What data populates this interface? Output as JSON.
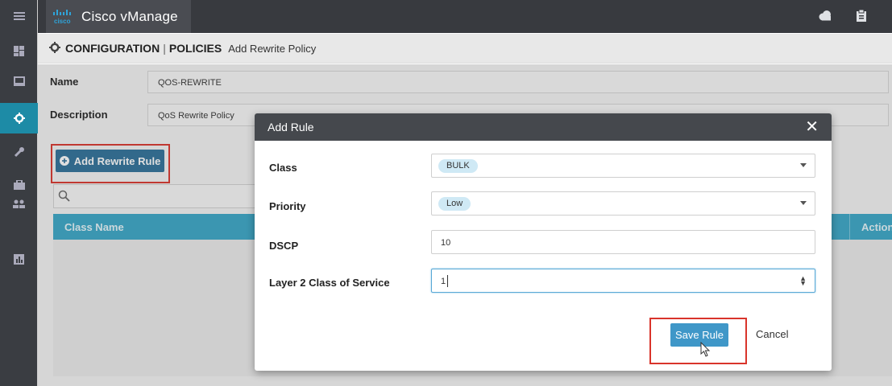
{
  "app": {
    "title": "Cisco vManage",
    "logo_text": "cisco"
  },
  "sidebar": {
    "items": [
      {
        "icon": "hamburger-menu-icon",
        "active": false
      },
      {
        "icon": "dashboard-icon",
        "active": false
      },
      {
        "icon": "monitor-icon",
        "active": false
      },
      {
        "icon": "gear-icon",
        "active": true
      },
      {
        "icon": "wrench-icon",
        "active": false
      },
      {
        "icon": "briefcase-icon",
        "active": false
      },
      {
        "icon": "users-icon",
        "active": false
      },
      {
        "icon": "analytics-icon",
        "active": false
      }
    ]
  },
  "topbar": {
    "icons": [
      "cloud-icon",
      "clipboard-icon"
    ]
  },
  "breadcrumb": {
    "section": "CONFIGURATION",
    "separator": "|",
    "area": "POLICIES",
    "page": "Add Rewrite Policy"
  },
  "form": {
    "name_label": "Name",
    "name_value": "QOS-REWRITE",
    "description_label": "Description",
    "description_value": "QoS Rewrite Policy"
  },
  "toolbar": {
    "add_rule_label": "Add Rewrite Rule"
  },
  "table": {
    "columns": [
      "Class Name",
      "Action"
    ]
  },
  "modal": {
    "title": "Add Rule",
    "fields": {
      "class_label": "Class",
      "class_value": "BULK",
      "priority_label": "Priority",
      "priority_value": "Low",
      "dscp_label": "DSCP",
      "dscp_value": "10",
      "cos_label": "Layer 2 Class of Service",
      "cos_value": "1"
    },
    "save_label": "Save Rule",
    "cancel_label": "Cancel"
  },
  "colors": {
    "accent": "#38a7c7",
    "highlight": "#d9342b",
    "primary_button": "#3f97c8",
    "sidebar": "#3a3d42"
  }
}
